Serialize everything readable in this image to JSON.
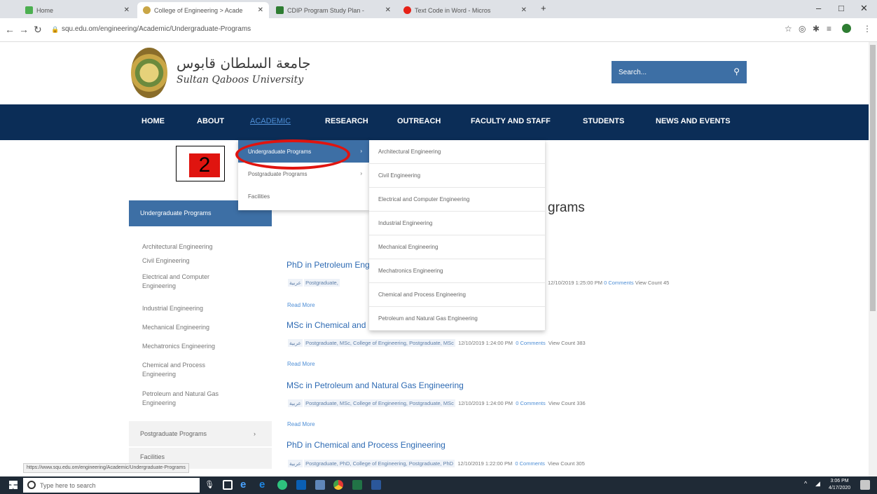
{
  "browser": {
    "tabs": [
      {
        "label": "Home",
        "active": false
      },
      {
        "label": "College of Engineering > Acade",
        "active": true
      },
      {
        "label": "CDIP Program Study Plan - ",
        "active": false
      },
      {
        "label": "Text Code in Word - Micros",
        "active": false
      }
    ],
    "new_tab_icon": "+",
    "url": "squ.edu.om/engineering/Academic/Undergraduate-Programs",
    "window_controls": [
      "–",
      "□",
      "✕"
    ],
    "status_url": "https://www.squ.edu.om/engineering/Academic/Undergraduate-Programs"
  },
  "site": {
    "logo_arabic": "جامعة السلطان قابوس",
    "logo_english": "Sultan Qaboos University",
    "search_placeholder": "Search...",
    "nav": [
      "HOME",
      "ABOUT",
      "ACADEMIC",
      "RESEARCH",
      "OUTREACH",
      "FACULTY AND STAFF",
      "STUDENTS",
      "NEWS AND EVENTS"
    ],
    "active_nav": "ACADEMIC"
  },
  "dropdown": {
    "level1": [
      {
        "label": "Undergraduate Programs",
        "selected": true,
        "has_sub": true
      },
      {
        "label": "Postgraduate Programs",
        "selected": false,
        "has_sub": true
      },
      {
        "label": "Facilities",
        "selected": false,
        "has_sub": false
      }
    ],
    "level2": [
      "Architectural Engineering",
      "Civil Engineering",
      "Electrical and Computer Engineering",
      "Industrial Engineering",
      "Mechanical Engineering",
      "Mechatronics Engineering",
      "Chemical and Process Engineering",
      "Petroleum and Natural Gas Engineering"
    ]
  },
  "callout": {
    "number": "2",
    "color": "#e0140f"
  },
  "sidebar": {
    "header": "Undergraduate Programs",
    "links": [
      "Architectural Engineering",
      "Civil Engineering",
      "Electrical and Computer Engineering",
      "Industrial Engineering",
      "Mechanical Engineering",
      "Mechatronics Engineering",
      "Chemical and Process Engineering",
      "Petroleum and Natural Gas Engineering"
    ],
    "postgrad": "Postgraduate Programs",
    "facilities": "Facilities"
  },
  "main": {
    "title_visible": "grams",
    "posts": [
      {
        "title": "PhD in Petroleum Eng",
        "tag_ar": "عربية",
        "cats": "Postgraduate,",
        "date": "12/10/2019 1:25:00 PM",
        "comments": "0 Comments",
        "views": "View Count 45",
        "read_more": "Read More"
      },
      {
        "title": "MSc in Chemical and",
        "tag_ar": "عربية",
        "cats": "Postgraduate, MSc, College of Engineering, Postgraduate, MSc",
        "date": "12/10/2019 1:24:00 PM",
        "comments": "0 Comments",
        "views": "View Count 383",
        "read_more": "Read More"
      },
      {
        "title": "MSc in Petroleum and Natural Gas Engineering",
        "tag_ar": "عربية",
        "cats": "Postgraduate, MSc, College of Engineering, Postgraduate, MSc",
        "date": "12/10/2019 1:24:00 PM",
        "comments": "0 Comments",
        "views": "View Count 336",
        "read_more": "Read More"
      },
      {
        "title": "PhD in Chemical and Process Engineering",
        "tag_ar": "عربية",
        "cats": "Postgraduate, PhD, College of Engineering, Postgraduate, PhD",
        "date": "12/10/2019 1:22:00 PM",
        "comments": "0 Comments",
        "views": "View Count 305",
        "read_more": ""
      }
    ]
  },
  "taskbar": {
    "search_placeholder": "Type here to search",
    "time": "3:06 PM",
    "date": "4/17/2020"
  }
}
